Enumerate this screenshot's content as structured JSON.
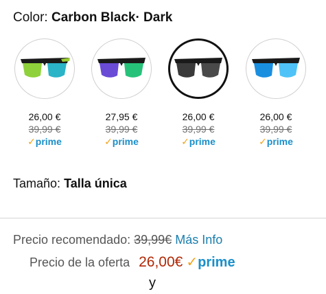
{
  "color": {
    "label": "Color:",
    "value": "Carbon Black· Dark"
  },
  "swatches": [
    {
      "price": "26,00 €",
      "old_price": "39,99 €",
      "prime": "prime",
      "lens": "#8fd13a",
      "lens2": "#2bb3c7",
      "frame": "#1a1a1a",
      "accent": "#9acd32"
    },
    {
      "price": "27,95 €",
      "old_price": "39,99 €",
      "prime": "prime",
      "lens": "#6a4bd6",
      "lens2": "#27c27a",
      "frame": "#1a1a1a",
      "accent": "#1a1a1a"
    },
    {
      "price": "26,00 €",
      "old_price": "39,99 €",
      "prime": "prime",
      "lens": "#3a3a3a",
      "lens2": "#5a5a5a",
      "frame": "#1a1a1a",
      "accent": "#1a1a1a"
    },
    {
      "price": "26,00 €",
      "old_price": "39,99 €",
      "prime": "prime",
      "lens": "#1a8fe0",
      "lens2": "#4fc3f7",
      "frame": "#1a1a1a",
      "accent": "#1a1a1a"
    }
  ],
  "size": {
    "label": "Tamaño:",
    "value": "Talla única"
  },
  "recommended": {
    "label": "Precio recomendado:",
    "price": "39,99€",
    "link": "Más Info"
  },
  "offer": {
    "label": "Precio de la oferta",
    "price": "26,00€",
    "prime": "prime"
  },
  "trailing": "y",
  "icons": {
    "check": "✓"
  },
  "colors": {
    "prime_blue": "#1a8fc9",
    "check_orange": "#f0a31b",
    "deal_red": "#b12704",
    "link_blue": "#1a7eae"
  }
}
